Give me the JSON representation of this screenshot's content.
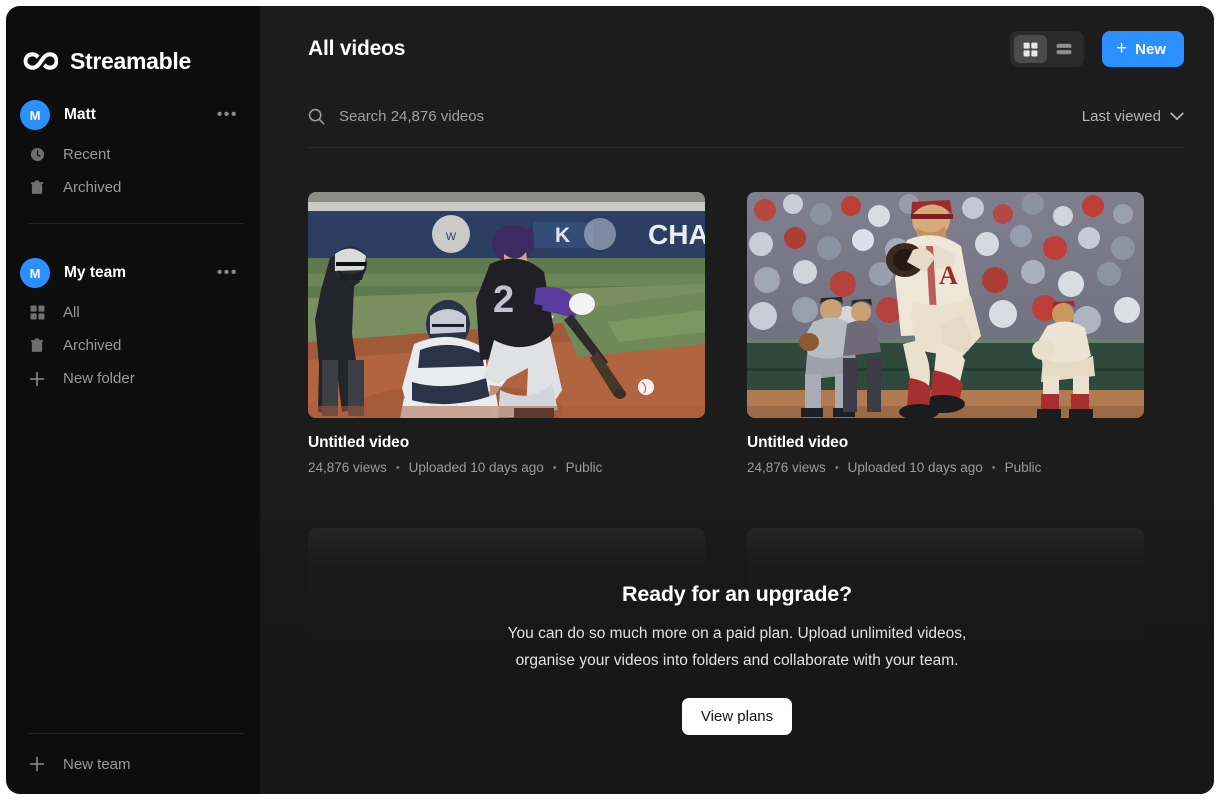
{
  "app": {
    "brand_name": "Streamable",
    "logo_icon": "infinity-logo-icon",
    "accent_color": "#2b8fff",
    "sidebar_bg": "#0d0d0d",
    "main_bg": "#1c1c1c"
  },
  "sidebar": {
    "account": {
      "avatar_initial": "M",
      "name": "Matt",
      "menu_icon": "more-horizontal-icon"
    },
    "account_items": [
      {
        "label": "Recent",
        "icon": "clock-icon"
      },
      {
        "label": "Archived",
        "icon": "trash-icon"
      }
    ],
    "team": {
      "avatar_initial": "M",
      "name": "My team",
      "menu_icon": "more-horizontal-icon"
    },
    "team_items": [
      {
        "label": "All",
        "icon": "grid-icon"
      },
      {
        "label": "Archived",
        "icon": "trash-icon"
      },
      {
        "label": "New folder",
        "icon": "plus-icon"
      }
    ],
    "footer": {
      "label": "New team",
      "icon": "plus-icon"
    }
  },
  "header": {
    "title": "All videos",
    "view_toggle": {
      "grid_icon": "grid-view-icon",
      "list_icon": "list-view-icon",
      "active": "grid"
    },
    "new_button": {
      "label": "New",
      "icon": "plus-icon"
    }
  },
  "search": {
    "icon": "search-icon",
    "placeholder": "Search 24,876 videos",
    "value": ""
  },
  "sort": {
    "label": "Last viewed",
    "icon": "chevron-down-icon"
  },
  "videos": [
    {
      "title": "Untitled video",
      "views": "24,876 views",
      "uploaded": "Uploaded 10 days ago",
      "visibility": "Public",
      "separator": "•",
      "thumbnail_alt": "baseball-batter-swinging"
    },
    {
      "title": "Untitled video",
      "views": "24,876 views",
      "uploaded": "Uploaded 10 days ago",
      "visibility": "Public",
      "separator": "•",
      "thumbnail_alt": "baseball-pitcher-windup"
    }
  ],
  "upgrade": {
    "title": "Ready for an upgrade?",
    "line1": "You can do so much more on a paid plan. Upload unlimited videos,",
    "line2": "organise your videos into folders and collaborate with your team.",
    "cta_label": "View plans"
  }
}
